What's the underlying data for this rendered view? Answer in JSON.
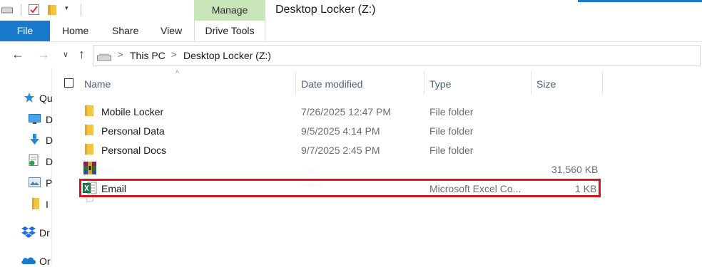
{
  "window": {
    "title": "Desktop Locker (Z:)",
    "manage_tab": "Manage"
  },
  "ribbon": {
    "tabs": [
      "File",
      "Home",
      "Share",
      "View",
      "Drive Tools"
    ]
  },
  "address": {
    "crumbs": [
      "This PC",
      "Desktop Locker (Z:)"
    ]
  },
  "nav_pane": {
    "items": [
      {
        "icon": "star-icon",
        "label": "Qu"
      },
      {
        "icon": "desktop-icon",
        "label": "D"
      },
      {
        "icon": "download-icon",
        "label": "D"
      },
      {
        "icon": "documents-icon",
        "label": "D"
      },
      {
        "icon": "pictures-icon",
        "label": "P"
      },
      {
        "icon": "folder-icon",
        "label": "I"
      },
      {
        "icon": "dropbox-icon",
        "label": "Dr"
      },
      {
        "icon": "onedrive-icon",
        "label": "Or"
      }
    ]
  },
  "columns": {
    "name": "Name",
    "date": "Date modified",
    "type": "Type",
    "size": "Size"
  },
  "files": [
    {
      "name": "Mobile Locker",
      "date": "7/26/2025 12:47 PM",
      "type": "File folder",
      "size": "",
      "icon": "folder-icon"
    },
    {
      "name": "Personal Data",
      "date": "9/5/2025 4:14 PM",
      "type": "File folder",
      "size": "",
      "icon": "folder-icon"
    },
    {
      "name": "Personal Docs",
      "date": "9/7/2025 2:45 PM",
      "type": "File folder",
      "size": "",
      "icon": "folder-icon"
    },
    {
      "name": "",
      "date": "",
      "type": "",
      "size": "31,560 KB",
      "icon": "archive-icon"
    },
    {
      "name": "Email",
      "date": "",
      "type": "Microsoft Excel Co...",
      "size": "1 KB",
      "icon": "excel-icon"
    }
  ],
  "colors": {
    "accent": "#1979ca",
    "manage": "#c8e6b8",
    "highlight": "#d8141d"
  }
}
